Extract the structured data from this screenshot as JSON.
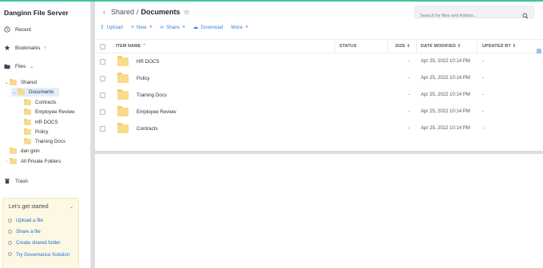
{
  "app": {
    "title": "Danginn File Server"
  },
  "sidebar": {
    "recent": "Recent",
    "bookmarks": "Bookmarks",
    "files": "Files",
    "tree": [
      {
        "label": "Shared",
        "level": 0,
        "expanded": true
      },
      {
        "label": "Documents",
        "level": 1,
        "expanded": true,
        "active": true
      },
      {
        "label": "Contracts",
        "level": 2
      },
      {
        "label": "Employee Review",
        "level": 2
      },
      {
        "label": "HR DOCS",
        "level": 2
      },
      {
        "label": "Policy",
        "level": 2
      },
      {
        "label": "Training Docs",
        "level": 2
      },
      {
        "label": "dan ginn",
        "level": 0
      },
      {
        "label": "All Private Folders",
        "level": 0,
        "collapsed": true
      }
    ],
    "trash": "Trash",
    "getting_started": {
      "title": "Let's get started",
      "items": [
        "Upload a file",
        "Share a file",
        "Create shared folder",
        "Try Governance Solution"
      ]
    }
  },
  "breadcrumb": {
    "parent": "Shared",
    "separator": "/",
    "current": "Documents"
  },
  "search": {
    "placeholder": "Search for files and folders..."
  },
  "toolbar": {
    "upload": "Upload",
    "new": "New",
    "share": "Share",
    "download": "Download",
    "more": "More"
  },
  "table": {
    "columns": {
      "name": "ITEM NAME",
      "status": "STATUS",
      "size": "SIZE",
      "date": "DATE MODIFIED",
      "updated_by": "UPDATED BY"
    },
    "rows": [
      {
        "name": "HR DOCS",
        "size": "-",
        "date": "Apr 25, 2022 10:14 PM",
        "updated_by": "-"
      },
      {
        "name": "Policy",
        "size": "-",
        "date": "Apr 25, 2022 10:14 PM",
        "updated_by": "-"
      },
      {
        "name": "Training Docs",
        "size": "-",
        "date": "Apr 25, 2022 10:14 PM",
        "updated_by": "-"
      },
      {
        "name": "Employee Review",
        "size": "-",
        "date": "Apr 25, 2022 10:14 PM",
        "updated_by": "-"
      },
      {
        "name": "Contracts",
        "size": "-",
        "date": "Apr 25, 2022 10:14 PM",
        "updated_by": "-"
      }
    ]
  },
  "colors": {
    "accent": "#3a86e0",
    "folder": "#f7dc8c",
    "top_bar": "#46c1a7",
    "panel": "#fdf8e4"
  }
}
